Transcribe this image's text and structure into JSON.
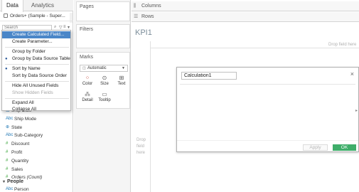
{
  "left_pane": {
    "tabs": [
      "Data",
      "Analytics"
    ],
    "datasource": "Orders+ (Sample - Super...",
    "search": {
      "placeholder": "Search"
    }
  },
  "context_menu": {
    "items": [
      {
        "label": "Create Calculated Field...",
        "state": "highlighted"
      },
      {
        "label": "Create Parameter...",
        "state": "normal"
      },
      {
        "label": "Group by Folder",
        "state": "normal"
      },
      {
        "label": "Group by Data Source Table",
        "state": "checked"
      },
      {
        "label": "Sort by Name",
        "state": "checked"
      },
      {
        "label": "Sort by Data Source Order",
        "state": "normal"
      },
      {
        "label": "Hide All Unused Fields",
        "state": "normal"
      },
      {
        "label": "Show Hidden Fields",
        "state": "disabled"
      },
      {
        "label": "Expand All",
        "state": "normal"
      },
      {
        "label": "Collapse All",
        "state": "normal"
      }
    ]
  },
  "fields": {
    "dimensions": [
      {
        "name": "Ship Date",
        "icon": "calendar-icon"
      },
      {
        "name": "Ship Mode",
        "icon": "abc-icon"
      },
      {
        "name": "State",
        "icon": "globe-icon"
      },
      {
        "name": "Sub-Category",
        "icon": "abc-icon"
      }
    ],
    "measures": [
      {
        "name": "Discount"
      },
      {
        "name": "Profit"
      },
      {
        "name": "Quantity"
      },
      {
        "name": "Sales"
      },
      {
        "name": "Orders (Count)"
      }
    ],
    "people_header": "People",
    "people_fields": [
      {
        "name": "Person"
      }
    ]
  },
  "mid": {
    "pages_title": "Pages",
    "filters_title": "Filters",
    "marks_title": "Marks",
    "mark_type": "Automatic",
    "mark_buttons": [
      "Color",
      "Size",
      "Text",
      "Detail",
      "Tooltip"
    ]
  },
  "canvas": {
    "columns_label": "Columns",
    "rows_label": "Rows",
    "sheet_title": "KPI1",
    "drop_top": "Drop field here",
    "drop_left": "Drop field here"
  },
  "dialog": {
    "calc_name": "Calculation1",
    "apply_label": "Apply",
    "ok_label": "OK"
  },
  "colors": {
    "highlight": "#4a86c8",
    "ok_green": "#3fae6a",
    "dimension_blue": "#1f77b4",
    "measure_green": "#2ca02c"
  }
}
